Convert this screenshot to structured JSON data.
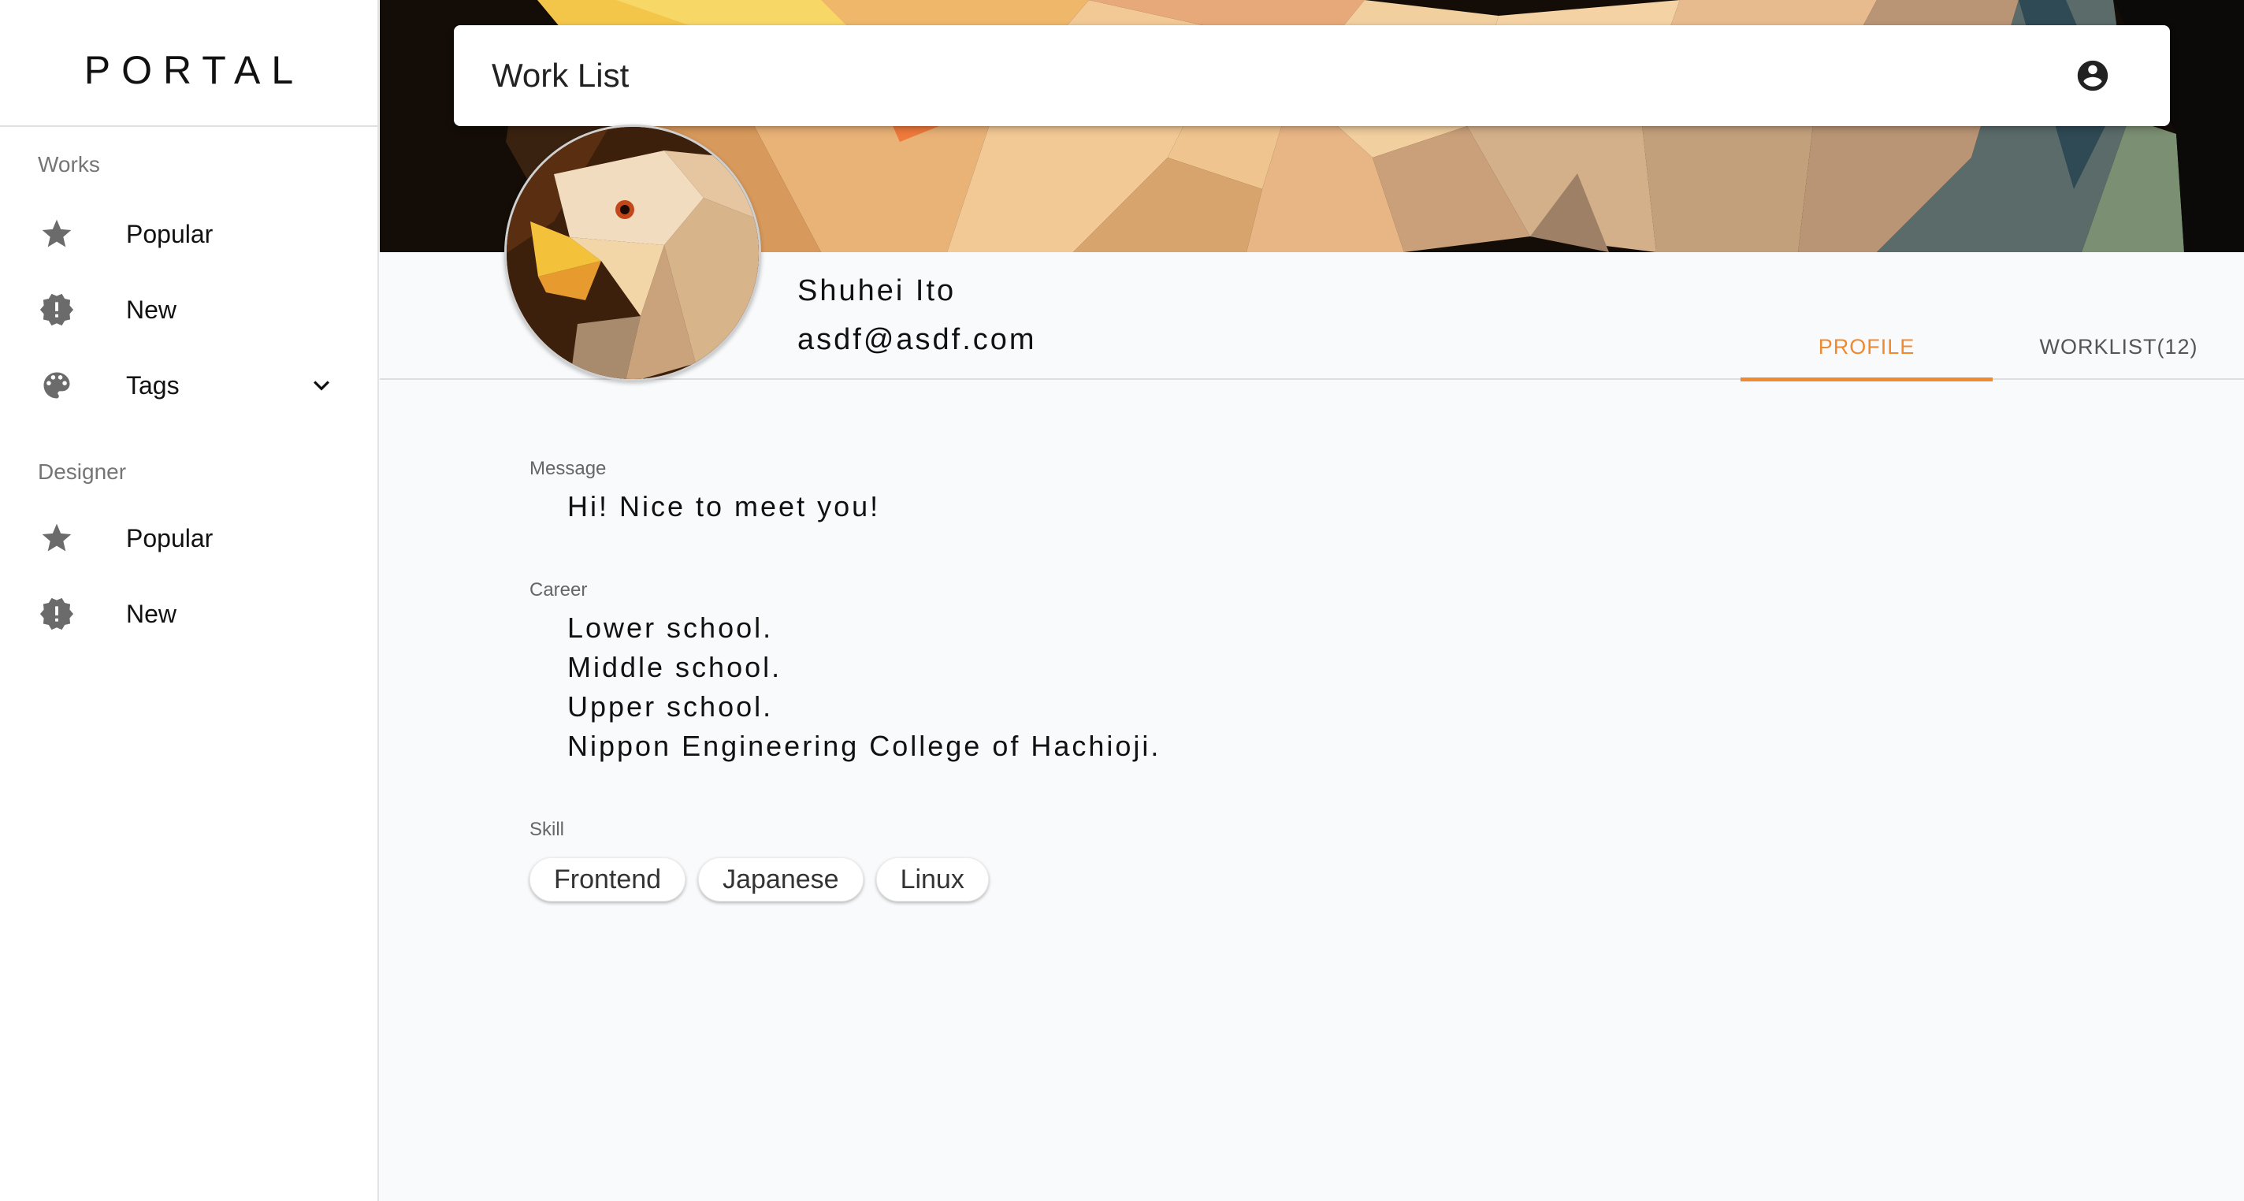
{
  "brand": "PORTAL",
  "sidebar": {
    "works_title": "Works",
    "works_items": [
      {
        "icon": "star-icon",
        "label": "Popular"
      },
      {
        "icon": "new-badge-icon",
        "label": "New"
      },
      {
        "icon": "palette-icon",
        "label": "Tags"
      }
    ],
    "designer_title": "Designer",
    "designer_items": [
      {
        "icon": "star-icon",
        "label": "Popular"
      },
      {
        "icon": "new-badge-icon",
        "label": "New"
      }
    ]
  },
  "appbar": {
    "title": "Work List",
    "account_icon": "account-circle-icon"
  },
  "profile": {
    "name": "Shuhei Ito",
    "email": "asdf@asdf.com"
  },
  "tabs": [
    {
      "label": "PROFILE",
      "active": true
    },
    {
      "label": "WORKLIST(12)",
      "active": false
    }
  ],
  "message": {
    "label": "Message",
    "text": "Hi! Nice to meet you!"
  },
  "career": {
    "label": "Career",
    "lines": [
      "Lower school.",
      "Middle school.",
      "Upper school.",
      "Nippon Engineering College of Hachioji."
    ]
  },
  "skill": {
    "label": "Skill",
    "chips": [
      "Frontend",
      "Japanese",
      "Linux"
    ]
  },
  "colors": {
    "accent": "#f08a30",
    "icon_gray": "#6b6b6b"
  }
}
